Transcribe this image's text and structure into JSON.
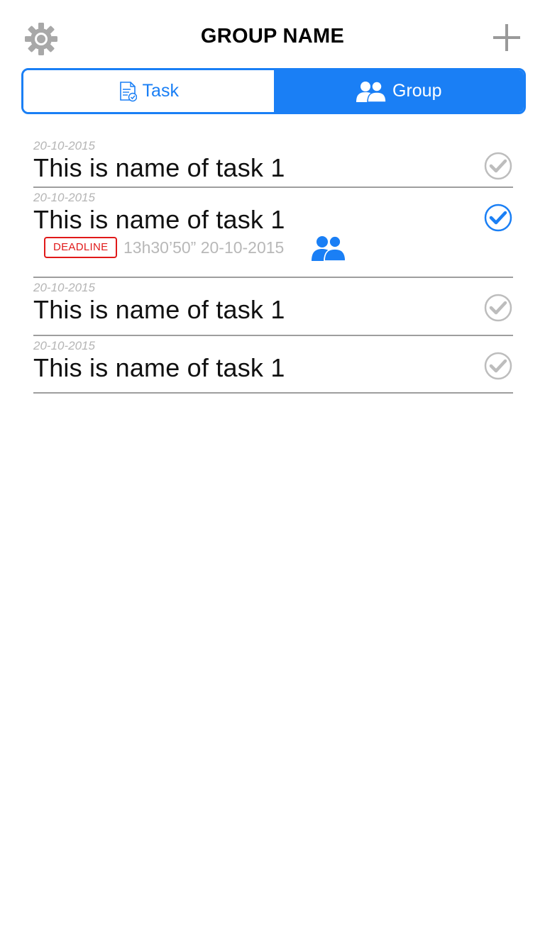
{
  "header": {
    "title": "GROUP NAME",
    "settings_icon": "gear-icon",
    "add_icon": "plus-icon"
  },
  "tabs": [
    {
      "label": "Task",
      "icon": "task-document-icon",
      "selected": false
    },
    {
      "label": "Group",
      "icon": "group-users-icon",
      "selected": true
    }
  ],
  "tasks": [
    {
      "date": "20-10-2015",
      "name": "This is name of task 1",
      "checked": false
    },
    {
      "date": "20-10-2015",
      "name": "This is name of task 1",
      "checked": true,
      "deadline_label": "DEADLINE",
      "deadline_time": "13h30’50” 20-10-2015",
      "group_icon": "group-users-icon"
    },
    {
      "date": "20-10-2015",
      "name": "This is name of task 1",
      "checked": false
    },
    {
      "date": "20-10-2015",
      "name": "This is name of task 1",
      "checked": false
    }
  ],
  "colors": {
    "accent": "#1a7ff5",
    "deadline": "#e01919",
    "muted": "#b5b5b5",
    "icon_gray": "#9e9e9e"
  }
}
